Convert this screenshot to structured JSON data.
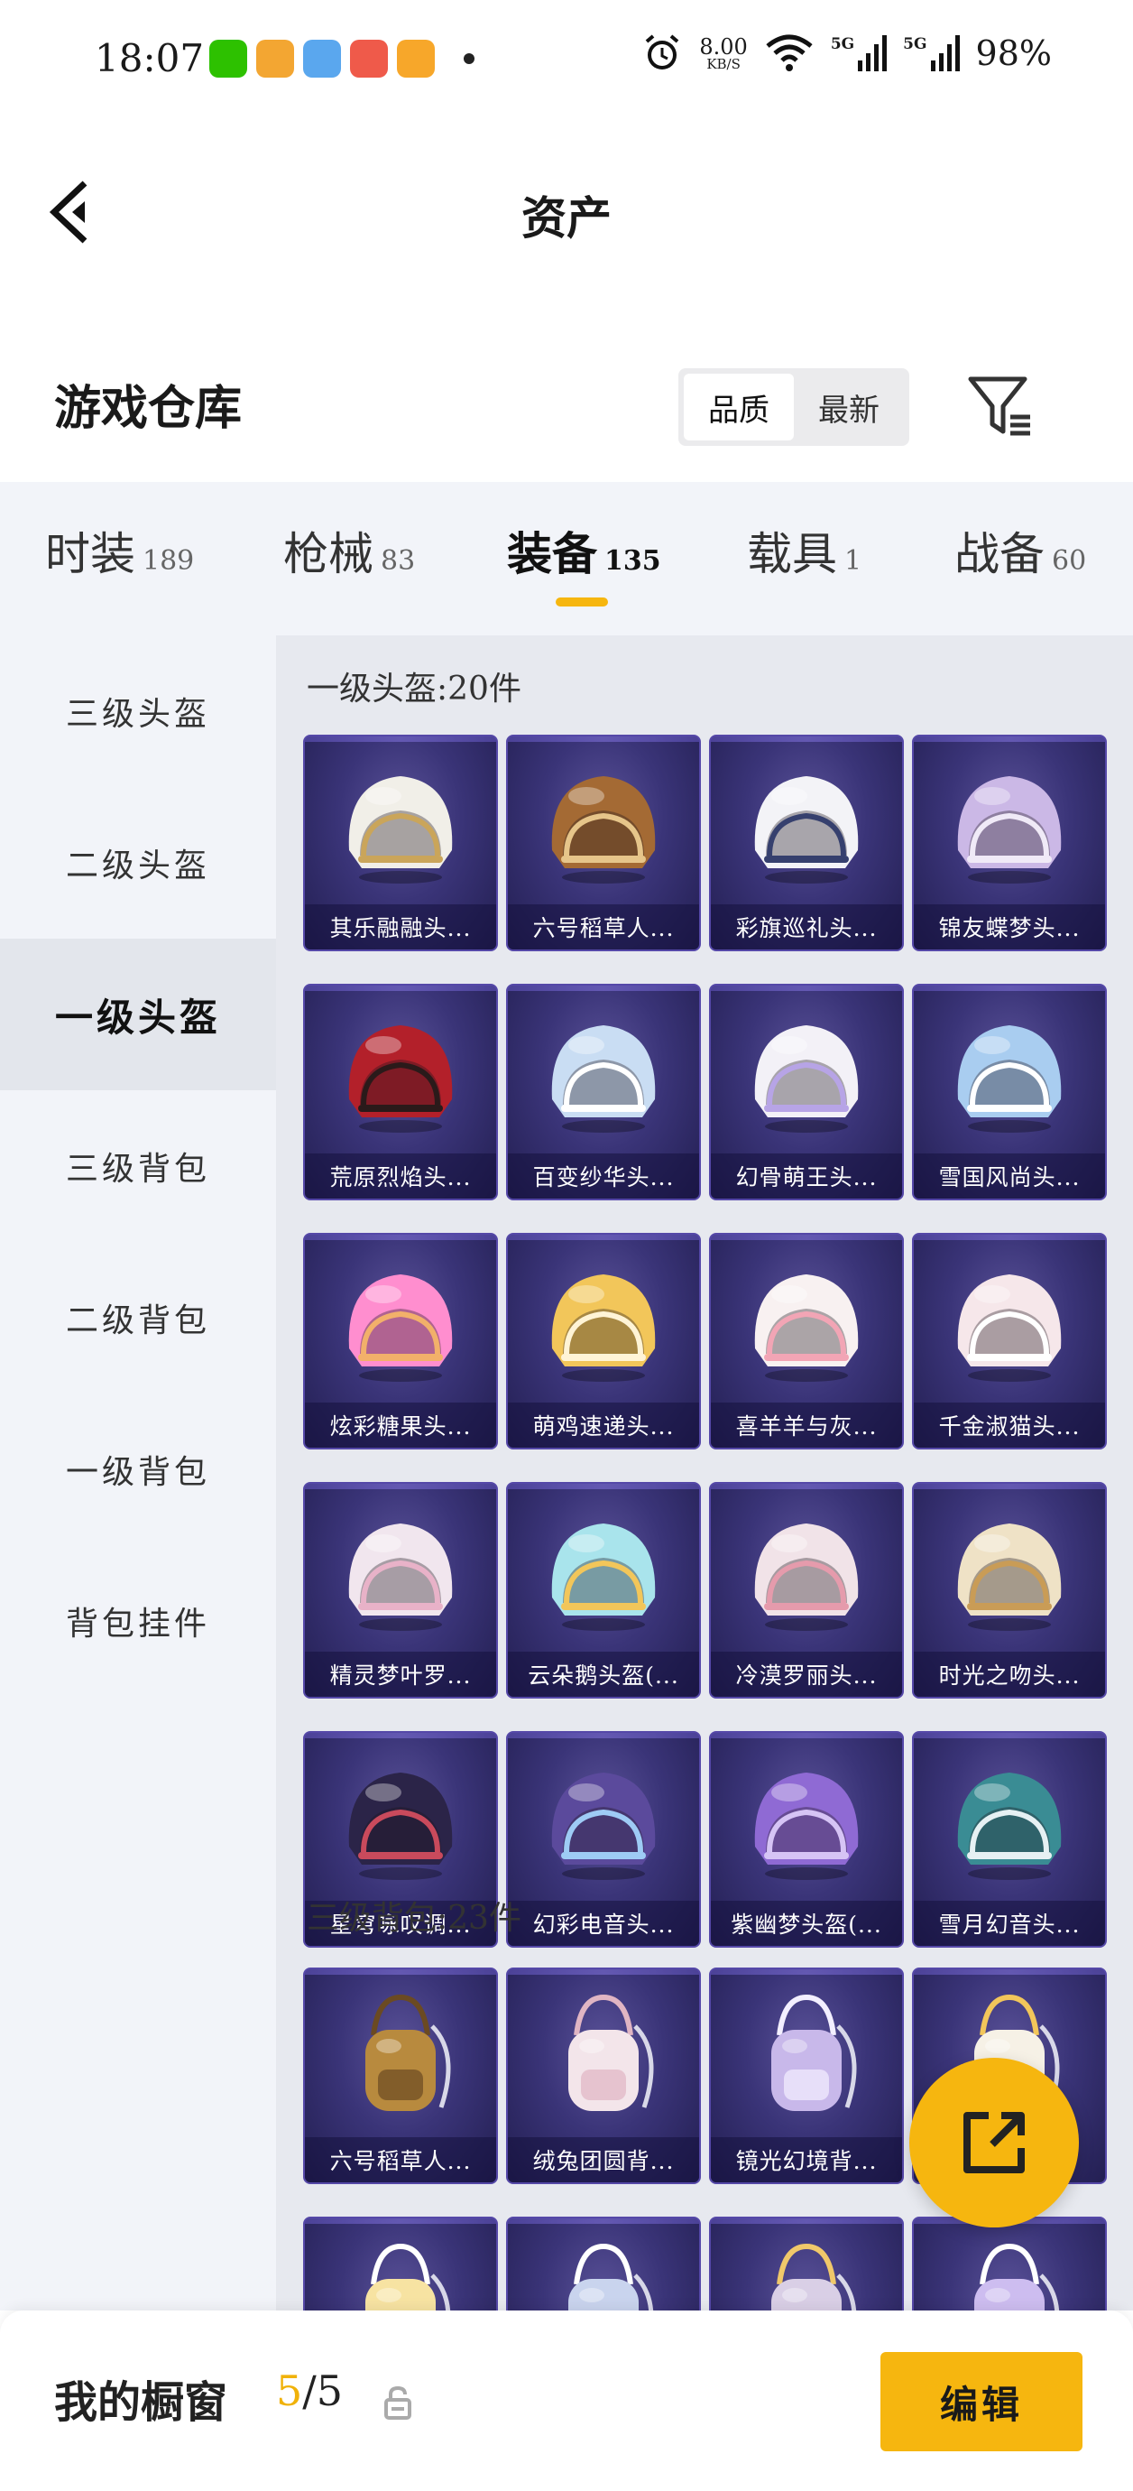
{
  "status_bar": {
    "time": "18:07",
    "net_speed_value": "8.00",
    "net_speed_unit": "KB/S",
    "sim1_tag": "5G",
    "sim2_tag": "5G",
    "battery": "98%"
  },
  "header": {
    "title": "资产"
  },
  "warehouse": {
    "title": "游戏仓库",
    "sort_options": [
      "品质",
      "最新"
    ],
    "sort_active_index": 0
  },
  "category_tabs": [
    {
      "name": "时装",
      "count": "189"
    },
    {
      "name": "枪械",
      "count": "83"
    },
    {
      "name": "装备",
      "count": "135"
    },
    {
      "name": "载具",
      "count": "1"
    },
    {
      "name": "战备",
      "count": "60"
    }
  ],
  "category_active_index": 2,
  "sidebar": {
    "items": [
      "三级头盔",
      "二级头盔",
      "一级头盔",
      "三级背包",
      "二级背包",
      "一级背包",
      "背包挂件"
    ],
    "active_index": 2
  },
  "sections": [
    {
      "title": "一级头盔:20件",
      "items": [
        {
          "label": "其乐融融头...",
          "color": "#f1efe8",
          "accent": "#caa55a"
        },
        {
          "label": "六号稻草人...",
          "color": "#a46a34",
          "accent": "#e6c58a"
        },
        {
          "label": "彩旗巡礼头...",
          "color": "#f3f3f7",
          "accent": "#36406e"
        },
        {
          "label": "锦友蝶梦头...",
          "color": "#cbb8e6",
          "accent": "#f0eaf7"
        },
        {
          "label": "荒原烈焰头...",
          "color": "#b3202a",
          "accent": "#2a1a1a"
        },
        {
          "label": "百变纱华头...",
          "color": "#c9ddf3",
          "accent": "#ffffff"
        },
        {
          "label": "幻骨萌王头...",
          "color": "#f3f1f7",
          "accent": "#b7a4e6"
        },
        {
          "label": "雪国风尚头...",
          "color": "#a9cdf0",
          "accent": "#ffffff"
        },
        {
          "label": "炫彩糖果头...",
          "color": "#ff8ecf",
          "accent": "#f2b06a"
        },
        {
          "label": "萌鸡速递头...",
          "color": "#f2c65a",
          "accent": "#fff4d6"
        },
        {
          "label": "喜羊羊与灰...",
          "color": "#f8f1f1",
          "accent": "#f2a5b5"
        },
        {
          "label": "千金淑猫头...",
          "color": "#f6e7ea",
          "accent": "#ffffff"
        },
        {
          "label": "精灵梦叶罗...",
          "color": "#f1e6ee",
          "accent": "#e8b2c8"
        },
        {
          "label": "云朵鹅头盔(...",
          "color": "#a9e4ec",
          "accent": "#f2c65a"
        },
        {
          "label": "冷漠罗丽头...",
          "color": "#f1e3e8",
          "accent": "#e59bac"
        },
        {
          "label": "时光之吻头...",
          "color": "#efe2c6",
          "accent": "#c99c56"
        },
        {
          "label": "星穹咏叹调...",
          "color": "#2b2448",
          "accent": "#c94a5c"
        },
        {
          "label": "幻彩电音头...",
          "color": "#5b4a9c",
          "accent": "#9ecbf5"
        },
        {
          "label": "紫幽梦头盔(...",
          "color": "#8f6ad4",
          "accent": "#d6c4f5"
        },
        {
          "label": "雪月幻音头...",
          "color": "#3a8c94",
          "accent": "#e6f0f3"
        }
      ]
    },
    {
      "title": "三级背包:23件",
      "items": [
        {
          "label": "六号稻草人...",
          "color": "#b88a3e",
          "accent": "#6b4a22"
        },
        {
          "label": "绒兔团圆背...",
          "color": "#f3e5ea",
          "accent": "#e0b5c3"
        },
        {
          "label": "镜光幻境背...",
          "color": "#c8b8ea",
          "accent": "#f3efff"
        },
        {
          "label": "",
          "color": "#f6f1e6",
          "accent": "#f2c65a"
        },
        {
          "label": "",
          "color": "#f7e3a2",
          "accent": "#ffffff"
        },
        {
          "label": "",
          "color": "#c9d4ee",
          "accent": "#ffffff"
        },
        {
          "label": "",
          "color": "#d9cfe6",
          "accent": "#f0c86a"
        },
        {
          "label": "",
          "color": "#cdbdf0",
          "accent": "#ffffff"
        }
      ]
    }
  ],
  "showcase": {
    "title": "我的橱窗",
    "current": "5",
    "separator": "/",
    "max": "5"
  },
  "edit_button_label": "编辑",
  "colors": {
    "accent": "#f6b60f",
    "card_bg": "#2e2866"
  }
}
